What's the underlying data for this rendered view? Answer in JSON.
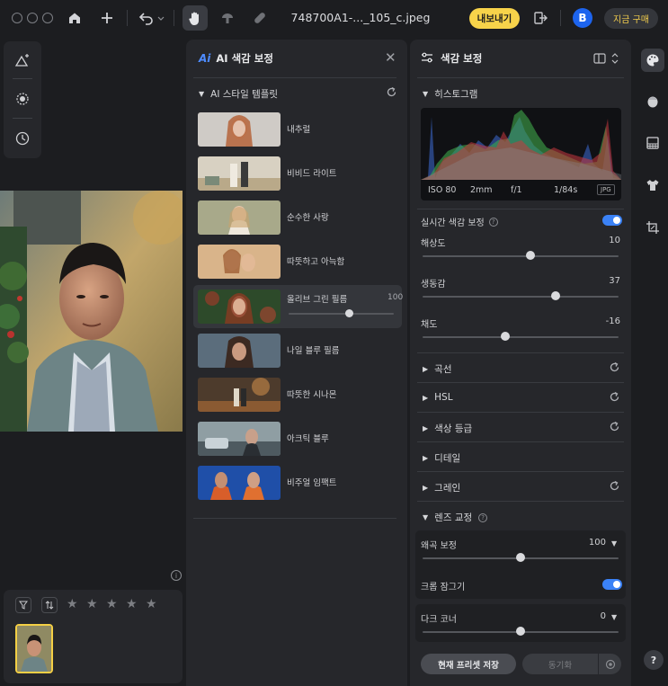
{
  "topbar": {
    "filename": "748700A1-..._105_c.jpeg",
    "export_label": "내보내기",
    "account_initial": "B",
    "buy_label": "지금 구매"
  },
  "ai_panel": {
    "ai_mark": "Ai",
    "title": "AI 색감 보정",
    "section_title": "AI 스타일 템플릿",
    "templates": [
      {
        "label": "내추럴"
      },
      {
        "label": "비비드 라이트"
      },
      {
        "label": "순수한 사랑"
      },
      {
        "label": "따뜻하고 아늑함"
      },
      {
        "label": "올리브 그린 필름",
        "value": "100"
      },
      {
        "label": "나일 블루 필름"
      },
      {
        "label": "따뜻한 시나몬"
      },
      {
        "label": "아크틱 블루"
      },
      {
        "label": "비주얼 임팩트"
      }
    ],
    "active_template_level": 0.58
  },
  "color_panel": {
    "title": "색감 보정",
    "histogram_title": "히스토그램",
    "meta": {
      "iso": "ISO 80",
      "focal": "2mm",
      "aperture": "f/1",
      "shutter": "1/84s",
      "format": "JPG"
    },
    "realtime_label": "실시간 색감 보정",
    "realtime_on": true,
    "sliders": [
      {
        "label": "해상도",
        "value": "10",
        "level": 0.55
      },
      {
        "label": "생동감",
        "value": "37",
        "level": 0.68
      },
      {
        "label": "채도",
        "value": "-16",
        "level": 0.42
      }
    ],
    "sections": [
      {
        "label": "곡선",
        "reset": true
      },
      {
        "label": "HSL",
        "reset": true
      },
      {
        "label": "색상 등급",
        "reset": true
      },
      {
        "label": "디테일",
        "reset": false
      },
      {
        "label": "그레인",
        "reset": true
      }
    ],
    "lens": {
      "title": "렌즈 교정",
      "distortion_label": "왜곡 보정",
      "distortion_value": "100",
      "distortion_level": 0.5,
      "crop_lock_label": "크롭 잠그기",
      "crop_lock_on": true,
      "vignette_label": "다크 코너",
      "vignette_value": "0",
      "vignette_level": 0.5
    },
    "save_preset_label": "현재 프리셋 저장",
    "sync_label": "동기화"
  },
  "colors": {
    "accent_yellow": "#f7d34a",
    "accent_blue": "#3b82f6",
    "panel_bg": "#26272b",
    "app_bg": "#1c1d20"
  }
}
